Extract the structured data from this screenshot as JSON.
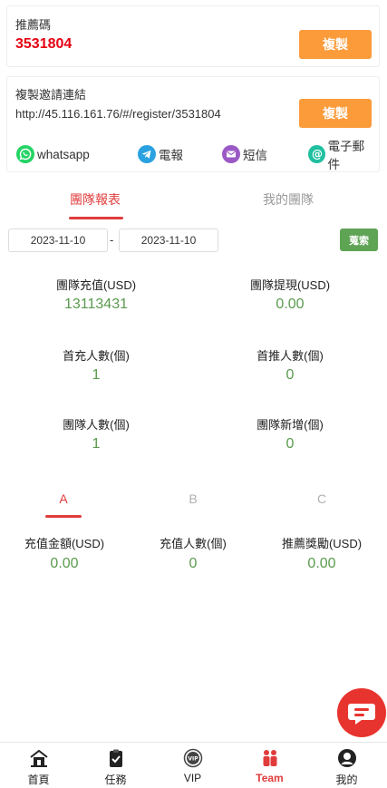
{
  "referral": {
    "label": "推薦碼",
    "code": "3531804",
    "copy_label": "複製"
  },
  "invite": {
    "label": "複製邀請連結",
    "link": "http://45.116.161.76/#/register/3531804",
    "copy_label": "複製",
    "shares": [
      {
        "label": "whatsapp",
        "icon": "whatsapp-icon",
        "color": "#25d366"
      },
      {
        "label": "電報",
        "icon": "telegram-icon",
        "color": "#2aa1e0"
      },
      {
        "label": "短信",
        "icon": "sms-icon",
        "color": "#9b59c6"
      },
      {
        "label": "電子郵件",
        "icon": "email-icon",
        "color": "#20c0a0"
      }
    ]
  },
  "team_tabs": [
    {
      "label": "團隊報表",
      "active": true
    },
    {
      "label": "我的團隊",
      "active": false
    }
  ],
  "filter": {
    "date_from": "2023-11-10",
    "separator": "-",
    "date_to": "2023-11-10",
    "search_label": "蒐索"
  },
  "stats": [
    {
      "label": "團隊充值(USD)",
      "value": "13113431"
    },
    {
      "label": "團隊提現(USD)",
      "value": "0.00"
    },
    {
      "label": "首充人數(個)",
      "value": "1"
    },
    {
      "label": "首推人數(個)",
      "value": "0"
    },
    {
      "label": "團隊人數(個)",
      "value": "1"
    },
    {
      "label": "團隊新增(個)",
      "value": "0"
    }
  ],
  "level_tabs": [
    {
      "label": "A",
      "active": true
    },
    {
      "label": "B",
      "active": false
    },
    {
      "label": "C",
      "active": false
    }
  ],
  "level_stats": [
    {
      "label": "充值金額(USD)",
      "value": "0.00"
    },
    {
      "label": "充值人數(個)",
      "value": "0"
    },
    {
      "label": "推薦獎勵(USD)",
      "value": "0.00"
    }
  ],
  "nav": [
    {
      "label": "首頁",
      "icon": "home-icon",
      "active": false
    },
    {
      "label": "任務",
      "icon": "task-icon",
      "active": false
    },
    {
      "label": "VIP",
      "icon": "vip-icon",
      "active": false
    },
    {
      "label": "Team",
      "icon": "team-icon",
      "active": true
    },
    {
      "label": "我的",
      "icon": "profile-icon",
      "active": false
    }
  ],
  "colors": {
    "accent_red": "#e03c3c",
    "copy_orange": "#fb9b3a",
    "value_green": "#5a9a4d",
    "search_green": "#5fa455",
    "chat_red": "#e8342e"
  }
}
